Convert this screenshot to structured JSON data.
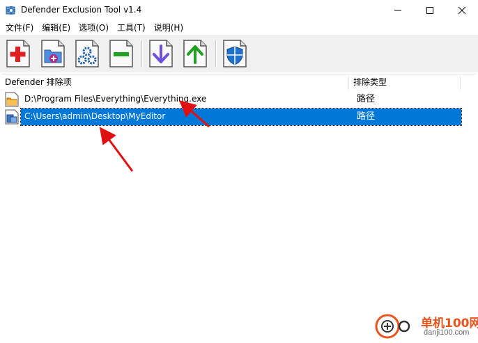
{
  "window": {
    "title": "Defender Exclusion Tool v1.4"
  },
  "menu": {
    "items": [
      {
        "label": "文件(F)"
      },
      {
        "label": "编辑(E)"
      },
      {
        "label": "选项(O)"
      },
      {
        "label": "工具(T)"
      },
      {
        "label": "说明(H)"
      }
    ]
  },
  "toolbar": {
    "buttons": [
      {
        "icon": "add-file-icon",
        "accent": "#e02020"
      },
      {
        "icon": "add-folder-icon",
        "accent": "#c0208a"
      },
      {
        "icon": "gears-icon",
        "accent": "#2060b0"
      },
      {
        "icon": "remove-icon",
        "accent": "#22a020"
      },
      {
        "icon": "arrow-down-icon",
        "accent": "#7050e0"
      },
      {
        "icon": "arrow-up-icon",
        "accent": "#22a020"
      },
      {
        "icon": "defender-shield-icon",
        "accent": "#1e70c8"
      }
    ]
  },
  "list": {
    "columns": [
      {
        "label": "Defender 排除项"
      },
      {
        "label": "排除类型"
      }
    ],
    "rows": [
      {
        "path": "D:\\Program Files\\Everything\\Everything.exe",
        "type": "路径",
        "icon": "file-icon",
        "selected": false
      },
      {
        "path": "C:\\Users\\admin\\Desktop\\MyEditor",
        "type": "路径",
        "icon": "folder-icon",
        "selected": true
      }
    ]
  },
  "watermark": {
    "cn": "单机100网",
    "en": "danji100.com"
  },
  "colors": {
    "selection": "#0078d7",
    "toolbar_bg": "#f0f0f0",
    "annotation_arrow": "#e01010"
  }
}
